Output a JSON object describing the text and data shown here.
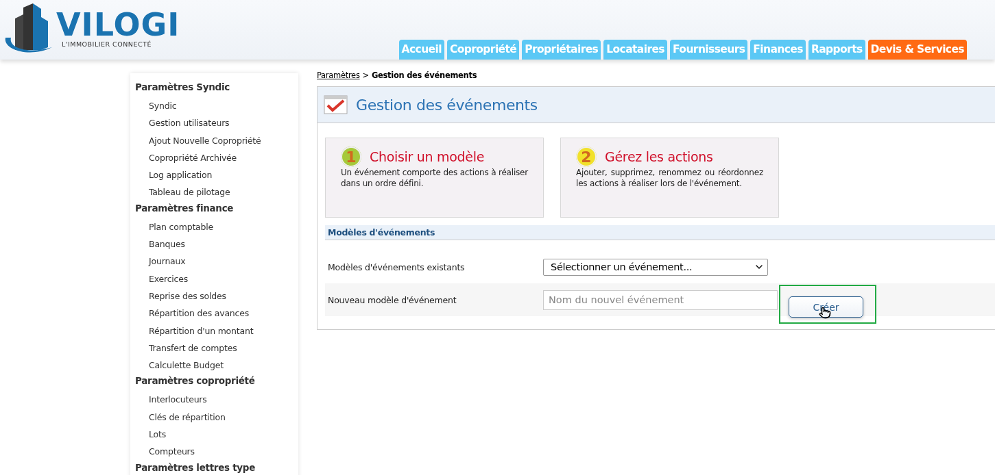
{
  "logo": {
    "name": "VILOGI",
    "tagline": "L'IMMOBILIER CONNECTÉ"
  },
  "tabs": [
    {
      "label": "Accueil",
      "color": "#5bc8f5"
    },
    {
      "label": "Copropriété",
      "color": "#5bc8f5"
    },
    {
      "label": "Propriétaires",
      "color": "#5bc8f5"
    },
    {
      "label": "Locataires",
      "color": "#5bc8f5"
    },
    {
      "label": "Fournisseurs",
      "color": "#5bc8f5"
    },
    {
      "label": "Finances",
      "color": "#5bc8f5"
    },
    {
      "label": "Rapports",
      "color": "#5bc8f5"
    },
    {
      "label": "Devis & Services",
      "color": "#ff6a13"
    }
  ],
  "sidebar": {
    "groups": [
      {
        "title": "Paramètres Syndic",
        "items": [
          "Syndic",
          "Gestion utilisateurs",
          "Ajout Nouvelle Copropriété",
          "Copropriété Archivée",
          "Log application",
          "Tableau de pilotage"
        ]
      },
      {
        "title": "Paramètres finance",
        "items": [
          "Plan comptable",
          "Banques",
          "Journaux",
          "Exercices",
          "Reprise des soldes",
          "Répartition des avances",
          "Répartition d'un montant",
          "Transfert de comptes",
          "Calculette Budget"
        ]
      },
      {
        "title": "Paramètres copropriété",
        "items": [
          "Interlocuteurs",
          "Clés de répartition",
          "Lots",
          "Compteurs"
        ]
      },
      {
        "title": "Paramètres lettres type"
      }
    ]
  },
  "breadcrumb": {
    "parent": "Paramètres",
    "separator": ">",
    "current": "Gestion des événements"
  },
  "page_title": "Gestion des événements",
  "steps": [
    {
      "number": "1",
      "title": "Choisir un modèle",
      "text": "Un événement comporte des actions à réaliser dans un ordre défini.",
      "color": "#a6c93a"
    },
    {
      "number": "2",
      "title": "Gérez les actions",
      "text": "Ajouter, supprimez, renommez ou réordonnez les actions à réaliser lors de l'événement.",
      "color": "#f2e12a"
    }
  ],
  "section": {
    "title": "Modèles d'événements",
    "existing_label": "Modèles d'événements existants",
    "select_value": "Sélectionner un événement...",
    "new_label": "Nouveau modèle d'événement",
    "new_placeholder": "Nom du nouvel événement",
    "create_button": {
      "label": "Créer",
      "highlighted": true
    }
  }
}
